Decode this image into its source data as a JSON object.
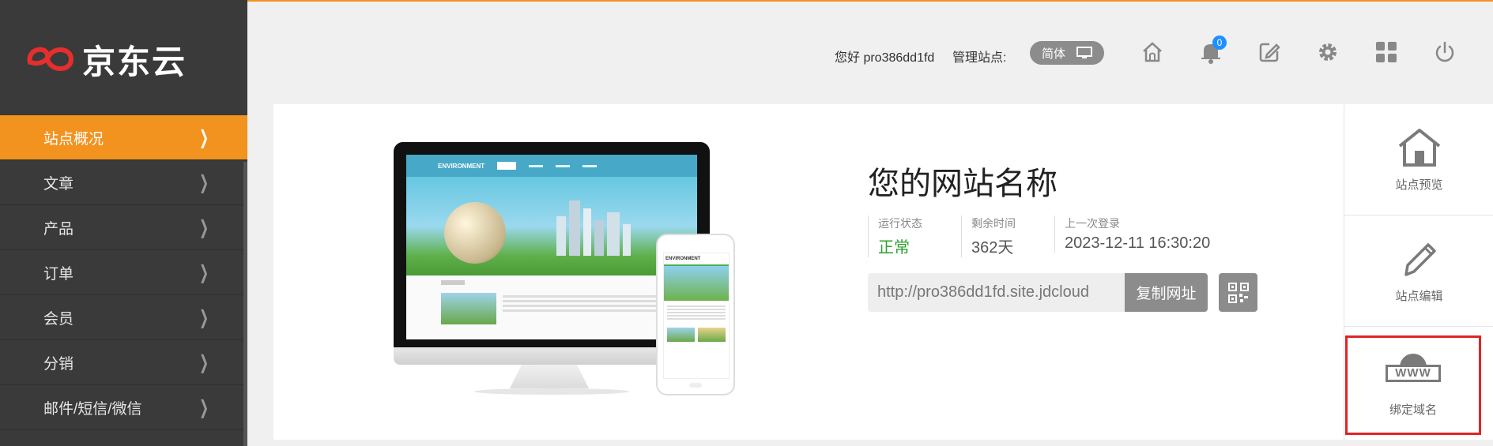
{
  "brand": {
    "logo_text": "京东云",
    "accent": "#f3931f"
  },
  "sidebar": {
    "items": [
      {
        "label": "站点概况",
        "active": true
      },
      {
        "label": "文章"
      },
      {
        "label": "产品"
      },
      {
        "label": "订单"
      },
      {
        "label": "会员"
      },
      {
        "label": "分销"
      },
      {
        "label": "邮件/短信/微信"
      }
    ]
  },
  "header": {
    "greeting": "您好 pro386dd1fd",
    "manage_label": "管理站点:",
    "lang": "简体",
    "notification_count": "0",
    "icons": [
      "home-icon",
      "bell-icon",
      "edit-icon",
      "gear-icon",
      "grid-icon",
      "power-icon"
    ]
  },
  "mockup": {
    "desktop_brand": "ENVIRONMENT",
    "phone_brand": "ENVIRONMENT"
  },
  "site": {
    "title": "您的网站名称",
    "status_label": "运行状态",
    "status_value": "正常",
    "remaining_label": "剩余时间",
    "remaining_value": "362天",
    "last_login_label": "上一次登录",
    "last_login_value": "2023-12-11 16:30:20",
    "url": "http://pro386dd1fd.site.jdcloud",
    "copy_label": "复制网址"
  },
  "right_panel": {
    "preview_label": "站点预览",
    "edit_label": "站点编辑",
    "domain_label": "绑定域名",
    "domain_icon_text": "WWW"
  }
}
